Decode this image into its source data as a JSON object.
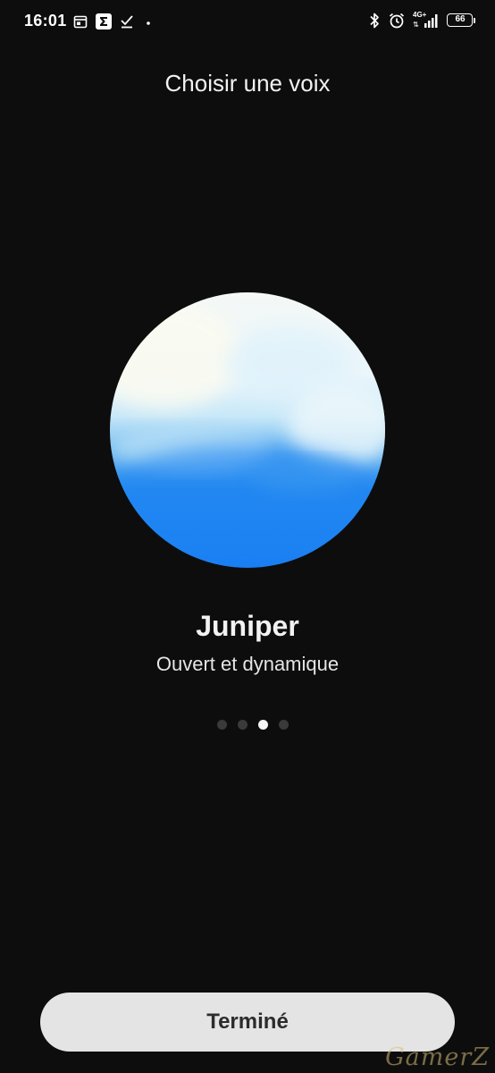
{
  "status_bar": {
    "time": "16:01",
    "left_icons": [
      "calendar-icon",
      "sigma-icon",
      "checkmark-icon",
      "dot-icon"
    ],
    "right_icons": [
      "bluetooth-icon",
      "alarm-icon",
      "signal-icon",
      "battery-icon"
    ],
    "network": "4G+",
    "battery_level": "66"
  },
  "header": {
    "title": "Choisir une voix"
  },
  "voice": {
    "name": "Juniper",
    "description": "Ouvert et dynamique",
    "orb_colors": [
      "#f4f8f6",
      "#c8e8f8",
      "#1a7cf3"
    ]
  },
  "pager": {
    "total": 4,
    "active_index": 2
  },
  "footer": {
    "done_label": "Terminé"
  },
  "watermark": "GamerZ",
  "colors": {
    "background": "#0d0d0d",
    "button_background": "#e4e4e4",
    "button_text": "#2c2c2c"
  }
}
